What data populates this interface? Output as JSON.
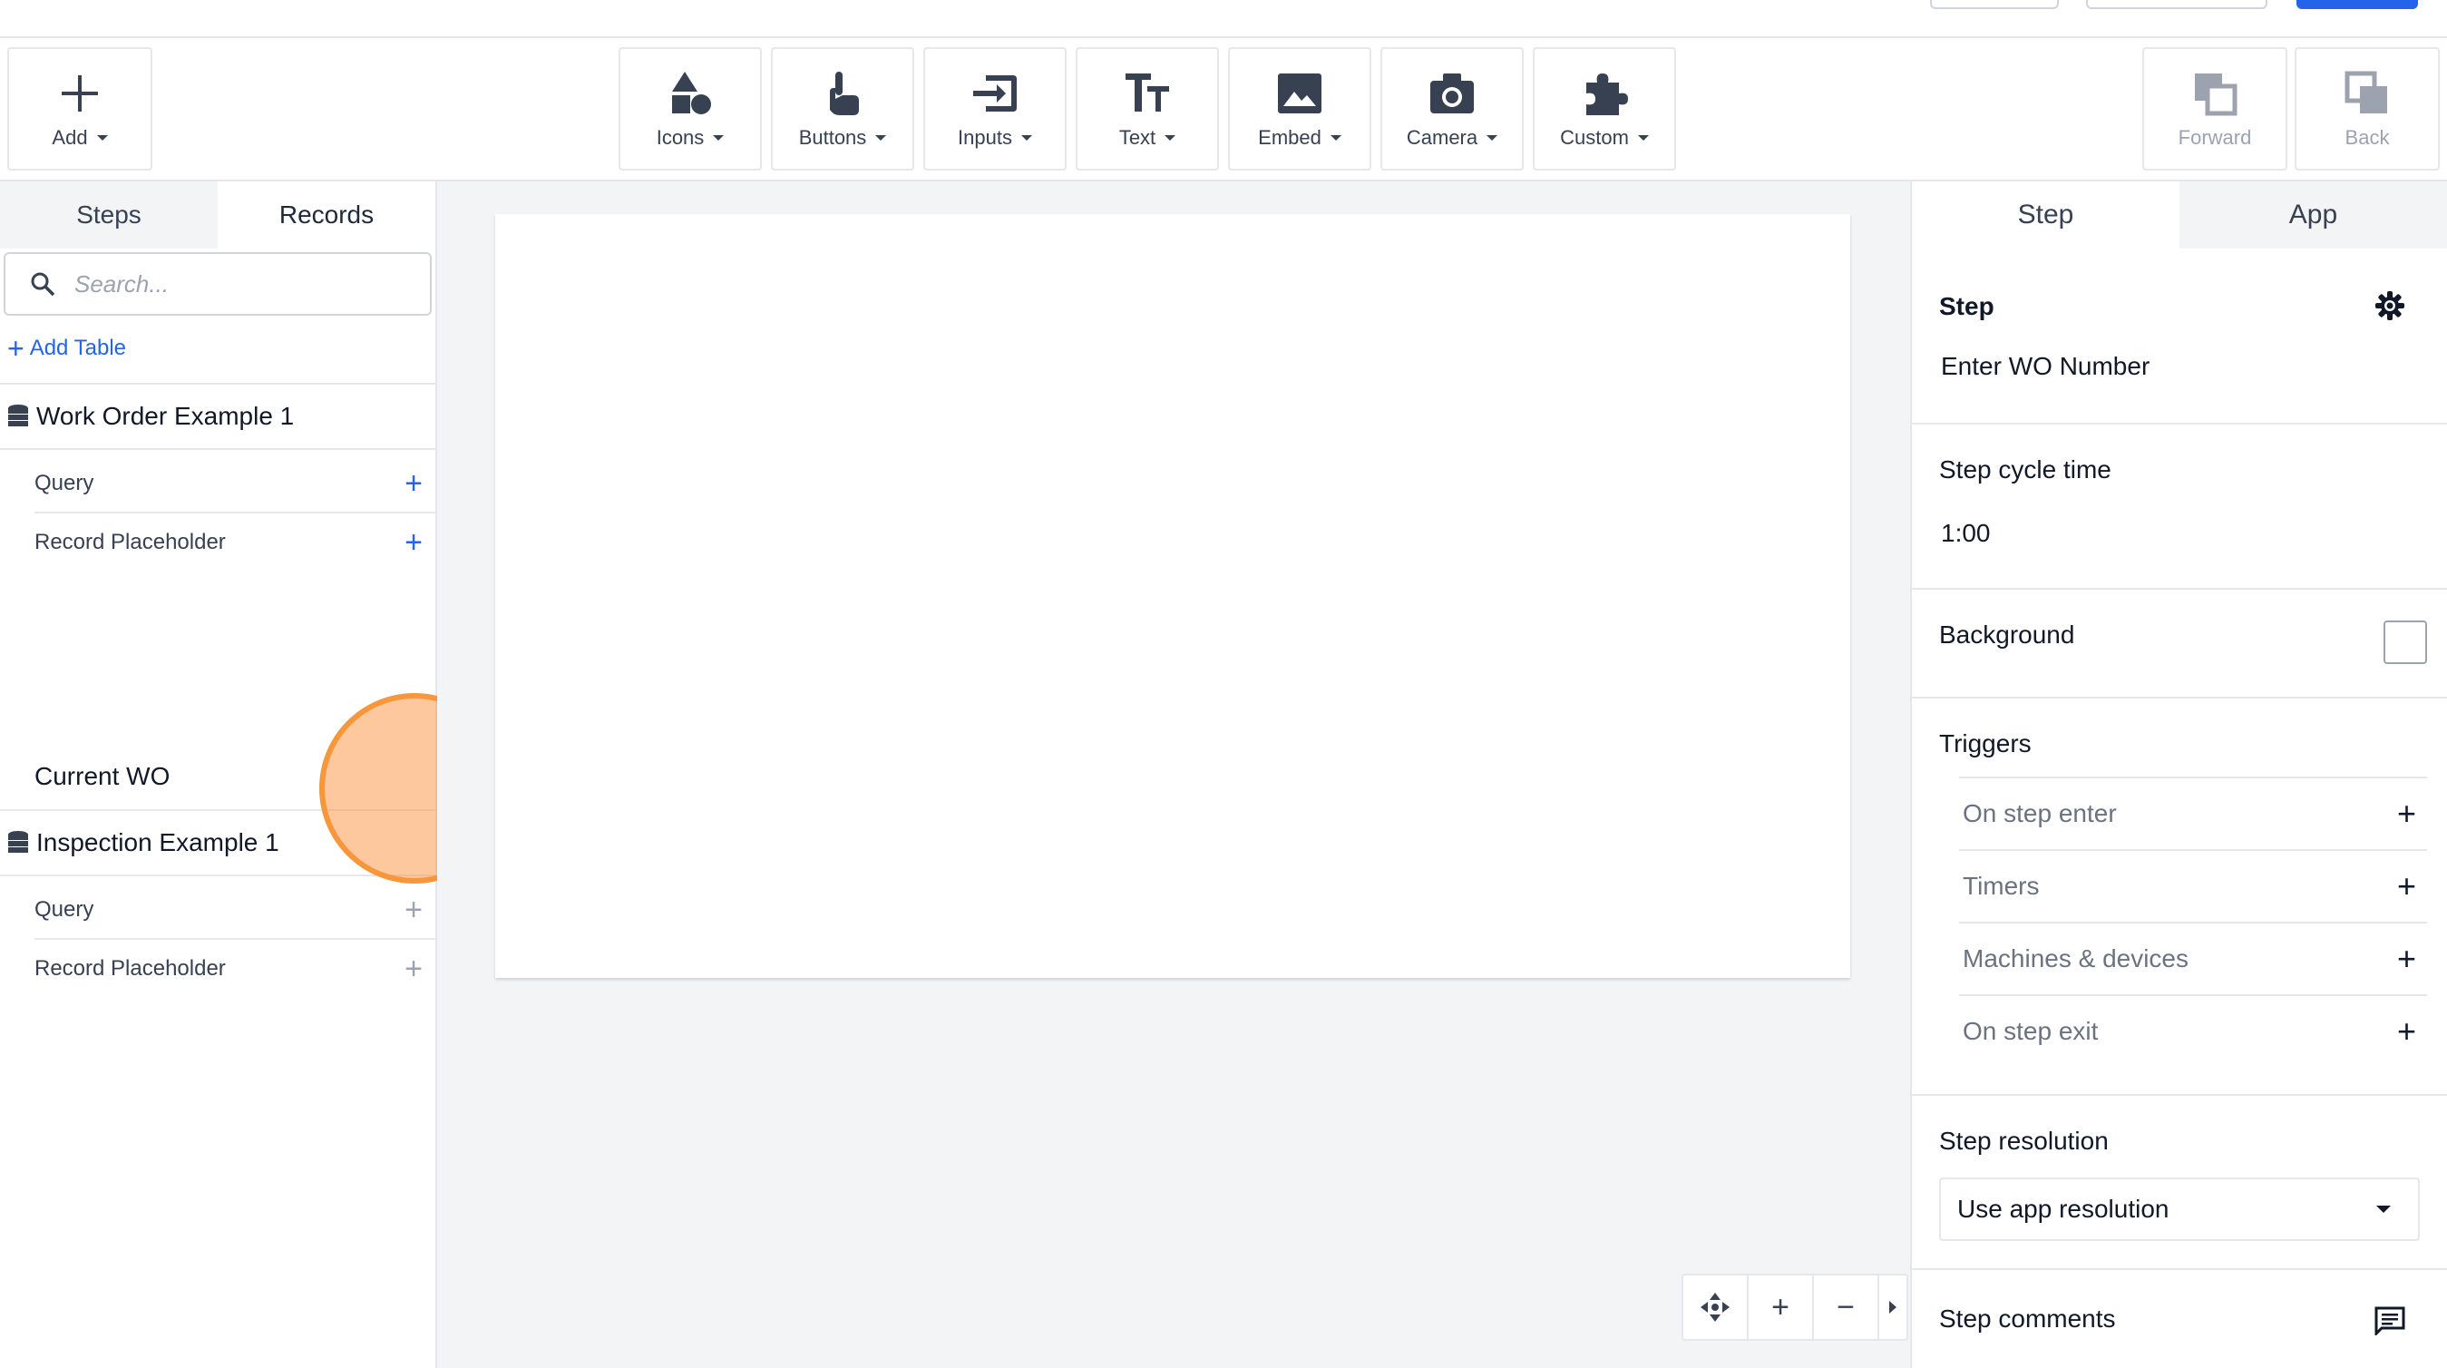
{
  "toolbar": {
    "add": "Add",
    "icons": "Icons",
    "buttons": "Buttons",
    "inputs": "Inputs",
    "text": "Text",
    "embed": "Embed",
    "camera": "Camera",
    "custom": "Custom",
    "forward": "Forward",
    "back": "Back"
  },
  "left": {
    "tabs": [
      "Steps",
      "Records"
    ],
    "search_placeholder": "Search...",
    "add_table": "Add Table",
    "tables": [
      {
        "name": "Work Order Example 1",
        "rows": [
          "Query",
          "Record Placeholder"
        ],
        "placeholder_name": "Current WO"
      },
      {
        "name": "Inspection Example 1",
        "rows": [
          "Query",
          "Record Placeholder"
        ]
      }
    ]
  },
  "right": {
    "tabs": [
      "Step",
      "App"
    ],
    "step_label": "Step",
    "step_name": "Enter WO Number",
    "cycle_label": "Step cycle time",
    "cycle_value": "1:00",
    "background_label": "Background",
    "triggers_label": "Triggers",
    "triggers": [
      "On step enter",
      "Timers",
      "Machines & devices",
      "On step exit"
    ],
    "resolution_label": "Step resolution",
    "resolution_value": "Use app resolution",
    "comments_label": "Step comments"
  },
  "colors": {
    "accent": "#2563eb",
    "click_highlight": "#f7963a"
  }
}
